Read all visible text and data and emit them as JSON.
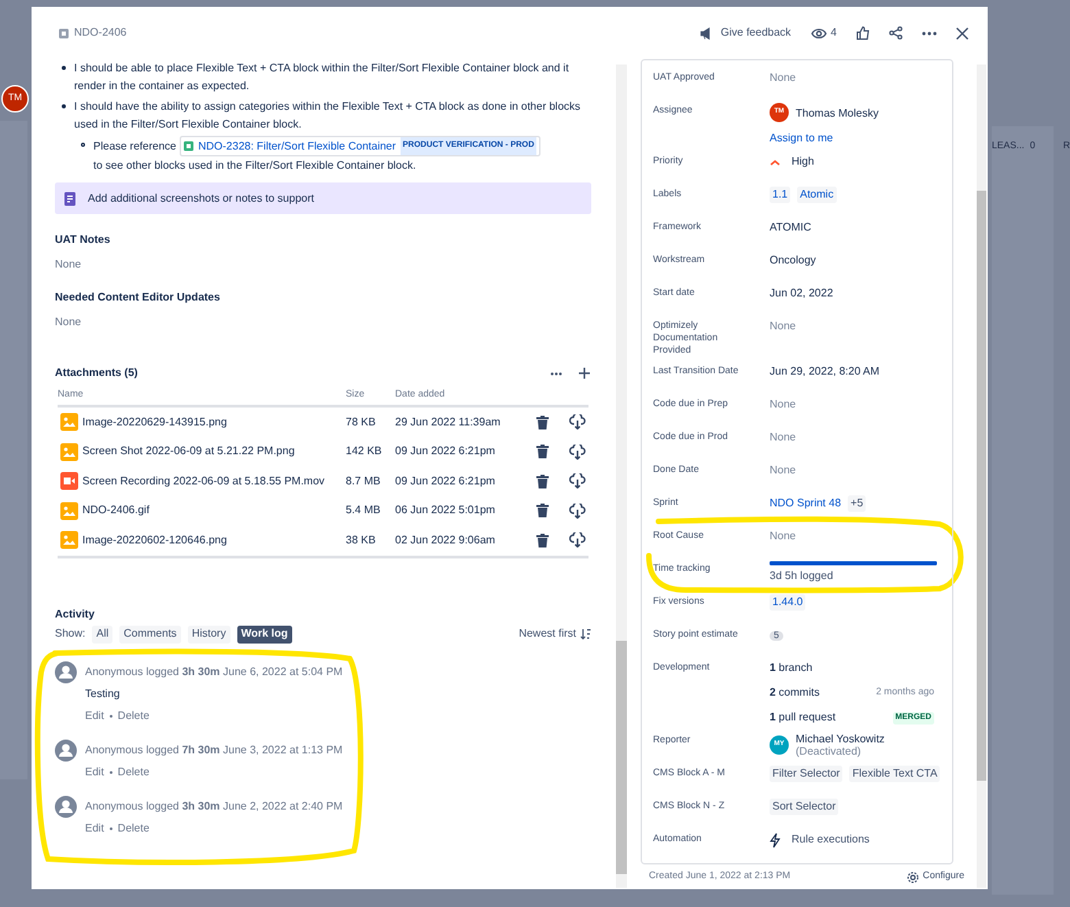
{
  "background": {
    "avatar": "TM",
    "column_title": "LEAS...",
    "column_count": "0",
    "column_2": "R"
  },
  "issue_key": "NDO-2406",
  "header": {
    "feedback": "Give feedback",
    "watchers": "4"
  },
  "description": {
    "bullets": [
      {
        "text": "I should be able to place Flexible Text + CTA block within the Filter/Sort Flexible Container block and it render in the container as expected."
      },
      {
        "text": "I should have the ability to assign categories within the Flexible Text + CTA block as done in other blocks used in the Filter/Sort Flexible Container block.",
        "children": [
          {
            "before": "Please reference",
            "link": "NDO-2328: Filter/Sort Flexible Container",
            "status": "PRODUCT VERIFICATION - PROD",
            "after": "to see other blocks used in the Filter/Sort Flexible Container block."
          }
        ]
      }
    ]
  },
  "note_panel": "Add additional screenshots or notes to support",
  "fields": [
    {
      "label": "UAT Notes",
      "value": "None"
    },
    {
      "label": "Needed Content Editor Updates",
      "value": "None"
    }
  ],
  "attachments": {
    "title": "Attachments (5)",
    "columns": [
      "Name",
      "Size",
      "Date added"
    ],
    "rows": [
      {
        "kind": "image",
        "name": "Image-20220629-143915.png",
        "size": "78 KB",
        "date": "29 Jun 2022 11:39am"
      },
      {
        "kind": "image",
        "name": "Screen Shot 2022-06-09 at 5.21.22 PM.png",
        "size": "142 KB",
        "date": "09 Jun 2022 6:21pm"
      },
      {
        "kind": "video",
        "name": "Screen Recording 2022-06-09 at 5.18.55 PM.mov",
        "size": "8.7 MB",
        "date": "09 Jun 2022 6:21pm"
      },
      {
        "kind": "image",
        "name": "NDO-2406.gif",
        "size": "5.4 MB",
        "date": "06 Jun 2022 5:01pm"
      },
      {
        "kind": "image",
        "name": "Image-20220602-120646.png",
        "size": "38 KB",
        "date": "02 Jun 2022 9:06am"
      }
    ]
  },
  "activity": {
    "title": "Activity",
    "show_label": "Show:",
    "filters": [
      {
        "label": "All",
        "selected": false
      },
      {
        "label": "Comments",
        "selected": false
      },
      {
        "label": "History",
        "selected": false
      },
      {
        "label": "Work log",
        "selected": true
      }
    ],
    "sort": "Newest first",
    "entries": [
      {
        "text": "Anonymous  logged **3h 30m** June 6, 2022 at 5:04 PM",
        "comment": "Testing",
        "actions": [
          "Edit",
          "Delete"
        ]
      },
      {
        "text": "Anonymous  logged **7h 30m** June 3, 2022 at 1:13 PM",
        "actions": [
          "Edit",
          "Delete"
        ]
      },
      {
        "text": "Anonymous  logged **3h 30m** June 2, 2022 at 2:40 PM",
        "actions": [
          "Edit",
          "Delete"
        ]
      }
    ]
  },
  "details": [
    {
      "kind": "empty",
      "label": "UAT Approved",
      "value": "None"
    },
    {
      "kind": "user",
      "label": "Assignee",
      "initials": "TM",
      "color": "#de350b",
      "value": "Thomas Molesky",
      "link": "Assign to me"
    },
    {
      "kind": "priority",
      "label": "Priority",
      "value": "High"
    },
    {
      "kind": "tags",
      "label": "Labels",
      "link_style": true,
      "tags": [
        "1.1",
        "Atomic"
      ]
    },
    {
      "kind": "text",
      "label": "Framework",
      "value": "ATOMIC"
    },
    {
      "kind": "text",
      "label": "Workstream",
      "value": "Oncology"
    },
    {
      "kind": "text",
      "label": "Start date",
      "value": "Jun 02, 2022"
    },
    {
      "kind": "empty",
      "label": "Optimizely Documentation Provided",
      "value": "None"
    },
    {
      "kind": "text",
      "label": "Last Transition Date",
      "value": "Jun 29, 2022, 8:20 AM"
    },
    {
      "kind": "empty",
      "label": "Code due in Prep",
      "value": "None"
    },
    {
      "kind": "empty",
      "label": "Code due in Prod",
      "value": "None"
    },
    {
      "kind": "empty",
      "label": "Done Date",
      "value": "None"
    },
    {
      "kind": "sprint",
      "label": "Sprint",
      "value": "NDO Sprint 48",
      "extra": "+5"
    },
    {
      "kind": "empty",
      "label": "Root Cause",
      "value": "None"
    },
    {
      "kind": "progress",
      "label": "Time tracking",
      "level": 1,
      "value": "3d 5h logged"
    },
    {
      "kind": "tags",
      "label": "Fix versions",
      "link_style": true,
      "tags": [
        "1.44.0"
      ]
    },
    {
      "kind": "count",
      "label": "Story point estimate",
      "value": "5"
    },
    {
      "kind": "development",
      "label": "Development",
      "items": [
        {
          "text": "**1** branch"
        },
        {
          "text": "**2** commits",
          "meta": "2 months ago"
        },
        {
          "text": "**1** pull request",
          "badge": "MERGED"
        }
      ]
    },
    {
      "kind": "user",
      "label": "Reporter",
      "initials": "MY",
      "color": "#00a3bf",
      "value": "Michael Yoskowitz",
      "sub": "(Deactivated)"
    },
    {
      "kind": "tags",
      "label": "CMS Block A - M",
      "link_style": false,
      "tags": [
        "Filter Selector",
        "Flexible Text CTA"
      ]
    },
    {
      "kind": "tags",
      "label": "CMS Block N - Z",
      "link_style": false,
      "tags": [
        "Sort Selector"
      ]
    },
    {
      "kind": "automation",
      "label": "Automation",
      "value": "Rule executions"
    }
  ],
  "footer": {
    "created": "Created June 1, 2022 at 2:13 PM",
    "configure": "Configure"
  }
}
